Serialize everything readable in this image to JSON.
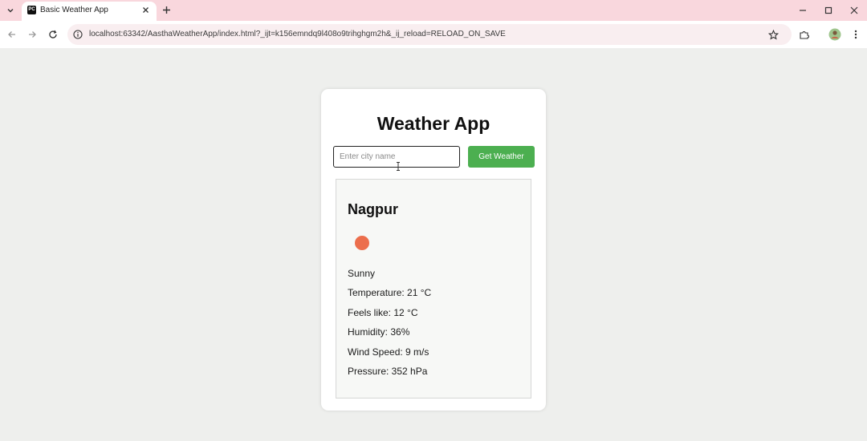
{
  "browser": {
    "tab_title": "Basic Weather App",
    "favicon_text": "PC",
    "url": "localhost:63342/AasthaWeatherApp/index.html?_ijt=k156emndq9l408o9trihghgm2h&_ij_reload=RELOAD_ON_SAVE",
    "colors": {
      "tabbar": "#f9d7dd",
      "omnibox": "#f9eef0"
    }
  },
  "app": {
    "title": "Weather App",
    "search": {
      "placeholder": "Enter city name",
      "value": ""
    },
    "button_label": "Get Weather",
    "colors": {
      "button": "#4caf50",
      "weather_icon": "#ec6e4c"
    }
  },
  "weather": {
    "city": "Nagpur",
    "icon": "sun-icon",
    "description": "Sunny",
    "temperature": "Temperature: 21 °C",
    "feels_like": "Feels like: 12 °C",
    "humidity": "Humidity: 36%",
    "wind_speed": "Wind Speed: 9 m/s",
    "pressure": "Pressure: 352 hPa"
  }
}
